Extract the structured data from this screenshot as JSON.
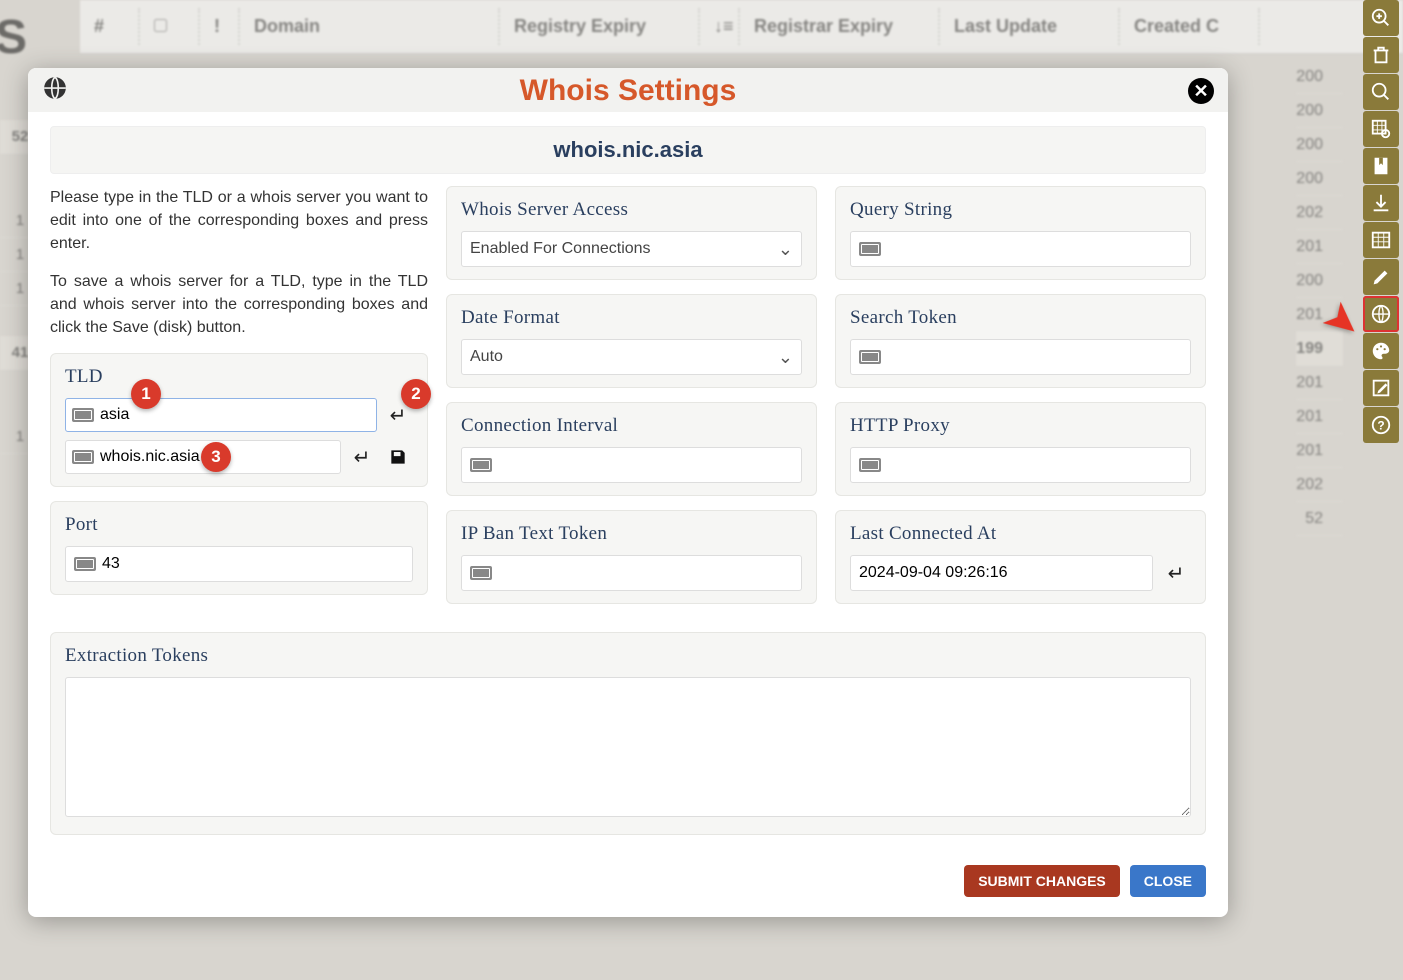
{
  "table": {
    "headers": [
      "#",
      "!",
      "Domain",
      "Registry Expiry",
      "Registrar Expiry",
      "Last Update",
      "Created C"
    ],
    "left_numbers": [
      "52",
      "1",
      "1",
      "1",
      "41",
      "1"
    ],
    "right_values": [
      "200",
      "200",
      "200",
      "200",
      "202",
      "201",
      "200",
      "201",
      "199",
      "201",
      "201",
      "201",
      "202",
      "52"
    ]
  },
  "toolbar_icons": [
    "zoom-in-icon",
    "trash-icon",
    "search-icon",
    "grid-search-icon",
    "bookmark-icon",
    "download-icon",
    "table-icon",
    "pencil-icon",
    "globe-icon",
    "palette-icon",
    "edit-box-icon",
    "help-icon"
  ],
  "modal": {
    "title": "Whois Settings",
    "subtitle": "whois.nic.asia",
    "intro1": "Please type in the TLD or a whois server you want to edit into one of the corresponding boxes and press enter.",
    "intro2": "To save a whois server for a TLD, type in the TLD and whois server into the corresponding boxes and click the Save (disk) button.",
    "tld": {
      "label": "TLD",
      "value": "asia",
      "whois_value": "whois.nic.asia"
    },
    "port": {
      "label": "Port",
      "value": "43"
    },
    "whois_access": {
      "label": "Whois Server Access",
      "selected": "Enabled For Connections"
    },
    "date_format": {
      "label": "Date Format",
      "selected": "Auto"
    },
    "connection_interval": {
      "label": "Connection Interval",
      "value": ""
    },
    "ip_ban_token": {
      "label": "IP Ban Text Token",
      "value": ""
    },
    "query_string": {
      "label": "Query String",
      "value": ""
    },
    "search_token": {
      "label": "Search Token",
      "value": ""
    },
    "http_proxy": {
      "label": "HTTP Proxy",
      "value": ""
    },
    "last_connected": {
      "label": "Last Connected At",
      "value": "2024-09-04 09:26:16"
    },
    "extraction": {
      "label": "Extraction Tokens",
      "value": ""
    },
    "buttons": {
      "submit": "SUBMIT CHANGES",
      "close": "CLOSE"
    },
    "badges": [
      "1",
      "2",
      "3"
    ]
  }
}
